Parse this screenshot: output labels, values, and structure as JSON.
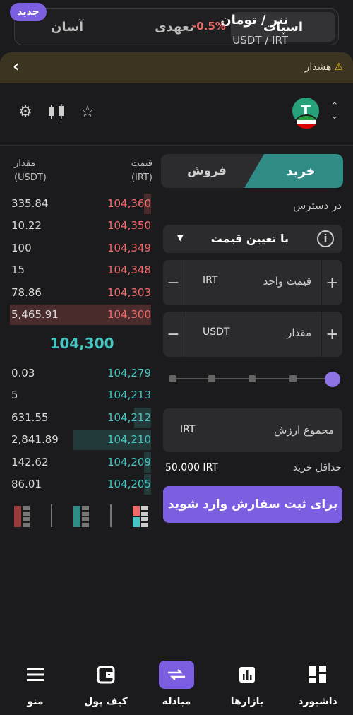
{
  "tabs": [
    {
      "label": "اسپات",
      "active": true
    },
    {
      "label": "تعهدی",
      "active": false
    },
    {
      "label": "آسان",
      "active": false
    }
  ],
  "badge_new": "جدید",
  "warning": {
    "label": "هشدار",
    "icon": "warning-icon"
  },
  "pair": {
    "title": "تتر / تومان",
    "symbol": "USDT / IRT",
    "change": "-0.5%",
    "coin_glyph": "T"
  },
  "orderbook": {
    "price_header": "قیمت",
    "price_unit": "(IRT)",
    "qty_header": "مقدار",
    "qty_unit": "(USDT)",
    "asks": [
      {
        "qty": "335.84",
        "price": "104,360",
        "depth": 0.05
      },
      {
        "qty": "10.22",
        "price": "104,350",
        "depth": 0.0
      },
      {
        "qty": "100",
        "price": "104,349",
        "depth": 0.0
      },
      {
        "qty": "15",
        "price": "104,348",
        "depth": 0.0
      },
      {
        "qty": "78.86",
        "price": "104,303",
        "depth": 0.0
      },
      {
        "qty": "5,465.91",
        "price": "104,300",
        "depth": 1.0
      }
    ],
    "mid_price": "104,300",
    "bids": [
      {
        "qty": "0.03",
        "price": "104,279",
        "depth": 0.0
      },
      {
        "qty": "5",
        "price": "104,213",
        "depth": 0.0
      },
      {
        "qty": "631.55",
        "price": "104,212",
        "depth": 0.12
      },
      {
        "qty": "2,841.89",
        "price": "104,210",
        "depth": 0.55
      },
      {
        "qty": "142.62",
        "price": "104,209",
        "depth": 0.05
      },
      {
        "qty": "86.01",
        "price": "104,205",
        "depth": 0.03
      }
    ]
  },
  "form": {
    "buy_label": "خرید",
    "sell_label": "فروش",
    "available_label": "در دسترس",
    "order_type": "با تعیین قیمت",
    "unit_price_label": "قیمت واحد",
    "unit_price_unit": "IRT",
    "amount_label": "مقدار",
    "amount_unit": "USDT",
    "total_label": "مجموع ارزش",
    "total_unit": "IRT",
    "min_buy_label": "حداقل خرید",
    "min_buy_value": "50,000 IRT",
    "submit_label": "برای ثبت سفارش وارد شوید",
    "slider_percent": 100
  },
  "bottom_nav": [
    {
      "label": "منو",
      "icon": "menu-icon",
      "active": false
    },
    {
      "label": "کیف پول",
      "icon": "wallet-icon",
      "active": false
    },
    {
      "label": "مبادله",
      "icon": "exchange-icon",
      "active": true
    },
    {
      "label": "بازارها",
      "icon": "markets-icon",
      "active": false
    },
    {
      "label": "داشبورد",
      "icon": "dashboard-icon",
      "active": false
    }
  ],
  "colors": {
    "accent": "#7c5fe0",
    "buy": "#2f8c86",
    "ask": "#f06a6a",
    "bid": "#46c6c2",
    "background": "#1b1b1d"
  }
}
